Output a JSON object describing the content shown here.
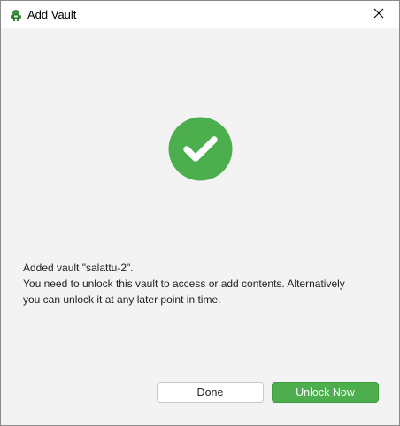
{
  "window": {
    "title": "Add Vault",
    "app_icon": "cryptomator-robot-icon",
    "close_icon": "close-icon"
  },
  "status": {
    "icon": "checkmark-circle-icon",
    "color": "#4cae4c"
  },
  "message": {
    "line1": "Added vault \"salattu-2\".",
    "line2": "You need to unlock this vault to access or add contents. Alternatively",
    "line3": "you can unlock it at any later point in time."
  },
  "buttons": {
    "done_label": "Done",
    "unlock_label": "Unlock Now"
  },
  "colors": {
    "accent": "#4cae4c",
    "background": "#f3f3f3",
    "titlebar": "#ffffff"
  }
}
